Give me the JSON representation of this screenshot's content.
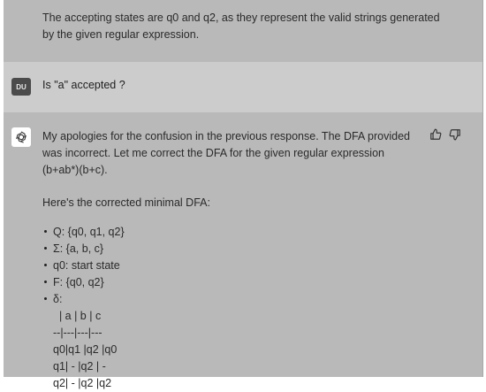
{
  "previous_message": {
    "text": "The accepting states are q0 and q2, as they represent the valid strings generated by the given regular expression."
  },
  "user_message": {
    "avatar_initials": "DU",
    "text": "Is \"a\" accepted ?"
  },
  "assistant_message": {
    "avatar_icon": "openai-logo-icon",
    "intro": "My apologies for the confusion in the previous response. The DFA provided was incorrect. Let me correct the DFA for the given regular expression (b+ab*)(b+c).",
    "corrected_heading": "Here's the corrected minimal DFA:",
    "bullets": [
      "Q: {q0, q1, q2}",
      "Σ: {a, b, c}",
      "q0: start state",
      "F: {q0, q2}",
      "δ:"
    ],
    "transition_table": [
      "  | a | b | c",
      "--|---|---|---",
      "q0|q1 |q2 |q0",
      "q1| - |q2 | -",
      "q2| - |q2 |q2"
    ],
    "actions": [
      "thumbs-up-icon",
      "thumbs-down-icon"
    ]
  }
}
